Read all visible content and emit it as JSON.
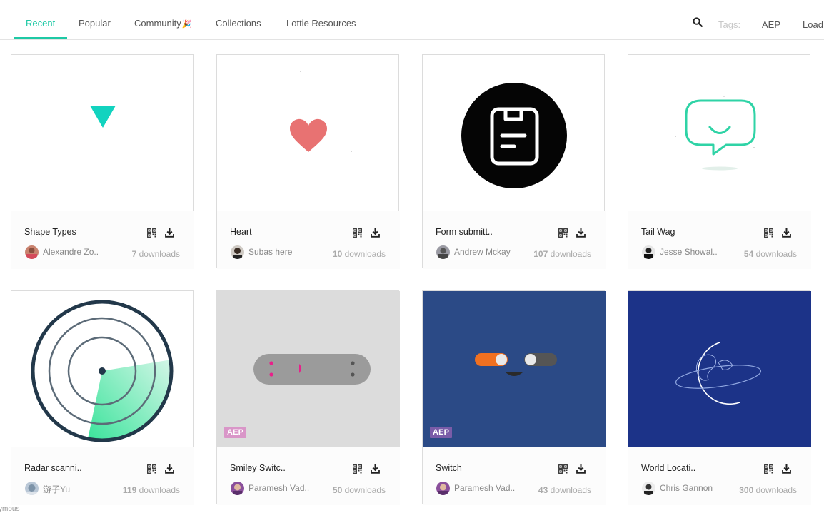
{
  "nav": {
    "tabs": [
      {
        "label": "Recent"
      },
      {
        "label": "Popular"
      },
      {
        "label": "Community"
      },
      {
        "label": "Collections"
      },
      {
        "label": "Lottie Resources"
      }
    ],
    "party_emoji": "🎉",
    "tags_label": "Tags:",
    "tag_links": [
      "AEP",
      "Load"
    ]
  },
  "cards": [
    {
      "title": "Shape Types",
      "author": "Alexandre Zo..",
      "downloads": "7",
      "downloads_suffix": " downloads",
      "preview": "triangle-icon"
    },
    {
      "title": "Heart",
      "author": "Subas here",
      "downloads": "10",
      "downloads_suffix": " downloads",
      "preview": "heart-icon"
    },
    {
      "title": "Form submitt..",
      "author": "Andrew Mckay",
      "downloads": "107",
      "downloads_suffix": " downloads",
      "preview": "clipboard-icon"
    },
    {
      "title": "Tail Wag",
      "author": "Jesse Showal..",
      "downloads": "54",
      "downloads_suffix": " downloads",
      "preview": "chat-bubble-icon"
    },
    {
      "title": "Radar scanni..",
      "author": "游子Yu",
      "downloads": "119",
      "downloads_suffix": " downloads",
      "preview": "radar-icon"
    },
    {
      "title": "Smiley Switc..",
      "author": "Paramesh Vad..",
      "downloads": "50",
      "downloads_suffix": " downloads",
      "preview": "switch-icon",
      "badge": "AEP",
      "badge_color": "#d996c8"
    },
    {
      "title": "Switch",
      "author": "Paramesh Vad..",
      "downloads": "43",
      "downloads_suffix": " downloads",
      "preview": "toggle-icon",
      "badge": "AEP",
      "badge_color": "#7a5ca8"
    },
    {
      "title": "World Locati..",
      "author": "Chris Gannon",
      "downloads": "300",
      "downloads_suffix": " downloads",
      "preview": "globe-icon"
    }
  ],
  "footer_fragment": "ymous",
  "colors": {
    "accent": "#1ec9a5",
    "heart": "#e87272",
    "switch_bg": "#2b4a86",
    "world_bg": "#1c3388",
    "smiley_bg": "#dcdcdc"
  }
}
